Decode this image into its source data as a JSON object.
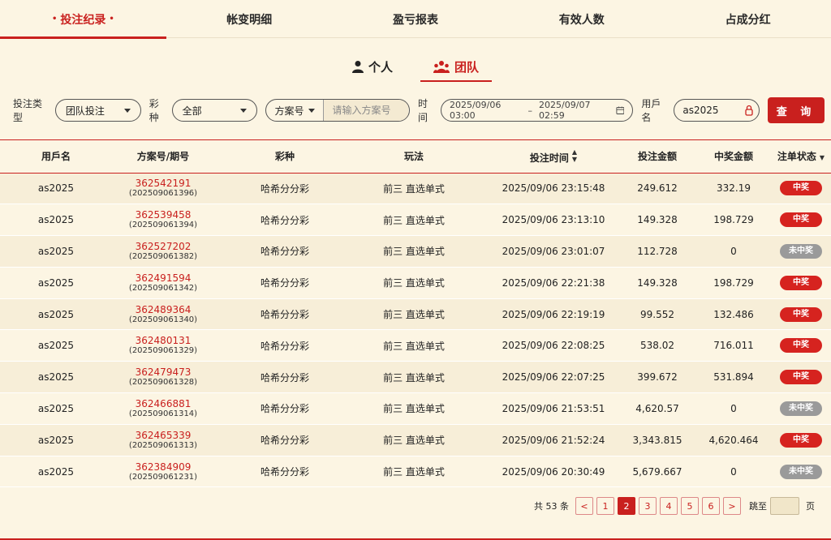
{
  "topnav": {
    "tabs": [
      {
        "label": "投注纪录",
        "active": true
      },
      {
        "label": "帐变明细",
        "active": false
      },
      {
        "label": "盈亏报表",
        "active": false
      },
      {
        "label": "有效人数",
        "active": false
      },
      {
        "label": "占成分红",
        "active": false
      }
    ]
  },
  "subtabs": {
    "personal": "个人",
    "team": "团队"
  },
  "filters": {
    "bet_type_label": "投注类型",
    "bet_type_value": "团队投注",
    "lottery_label": "彩种",
    "lottery_value": "全部",
    "plan_select_value": "方案号",
    "plan_input_placeholder": "请输入方案号",
    "time_label": "时间",
    "time_start": "2025/09/06 03:00",
    "time_sep": "–",
    "time_end": "2025/09/07 02:59",
    "username_label": "用戶名",
    "username_value": "as2025",
    "query_button": "查 询"
  },
  "table": {
    "headers": [
      "用戶名",
      "方案号/期号",
      "彩种",
      "玩法",
      "投注时间",
      "投注金额",
      "中奖金额",
      "注单状态"
    ],
    "rows": [
      {
        "user": "as2025",
        "plan": "362542191",
        "period": "(202509061396)",
        "lottery": "哈希分分彩",
        "play": "前三 直选单式",
        "time": "2025/09/06 23:15:48",
        "bet": "249.612",
        "win": "332.19",
        "status": "中奖"
      },
      {
        "user": "as2025",
        "plan": "362539458",
        "period": "(202509061394)",
        "lottery": "哈希分分彩",
        "play": "前三 直选单式",
        "time": "2025/09/06 23:13:10",
        "bet": "149.328",
        "win": "198.729",
        "status": "中奖"
      },
      {
        "user": "as2025",
        "plan": "362527202",
        "period": "(202509061382)",
        "lottery": "哈希分分彩",
        "play": "前三 直选单式",
        "time": "2025/09/06 23:01:07",
        "bet": "112.728",
        "win": "0",
        "status": "未中奖"
      },
      {
        "user": "as2025",
        "plan": "362491594",
        "period": "(202509061342)",
        "lottery": "哈希分分彩",
        "play": "前三 直选单式",
        "time": "2025/09/06 22:21:38",
        "bet": "149.328",
        "win": "198.729",
        "status": "中奖"
      },
      {
        "user": "as2025",
        "plan": "362489364",
        "period": "(202509061340)",
        "lottery": "哈希分分彩",
        "play": "前三 直选单式",
        "time": "2025/09/06 22:19:19",
        "bet": "99.552",
        "win": "132.486",
        "status": "中奖"
      },
      {
        "user": "as2025",
        "plan": "362480131",
        "period": "(202509061329)",
        "lottery": "哈希分分彩",
        "play": "前三 直选单式",
        "time": "2025/09/06 22:08:25",
        "bet": "538.02",
        "win": "716.011",
        "status": "中奖"
      },
      {
        "user": "as2025",
        "plan": "362479473",
        "period": "(202509061328)",
        "lottery": "哈希分分彩",
        "play": "前三 直选单式",
        "time": "2025/09/06 22:07:25",
        "bet": "399.672",
        "win": "531.894",
        "status": "中奖"
      },
      {
        "user": "as2025",
        "plan": "362466881",
        "period": "(202509061314)",
        "lottery": "哈希分分彩",
        "play": "前三 直选单式",
        "time": "2025/09/06 21:53:51",
        "bet": "4,620.57",
        "win": "0",
        "status": "未中奖"
      },
      {
        "user": "as2025",
        "plan": "362465339",
        "period": "(202509061313)",
        "lottery": "哈希分分彩",
        "play": "前三 直选单式",
        "time": "2025/09/06 21:52:24",
        "bet": "3,343.815",
        "win": "4,620.464",
        "status": "中奖"
      },
      {
        "user": "as2025",
        "plan": "362384909",
        "period": "(202509061231)",
        "lottery": "哈希分分彩",
        "play": "前三 直选单式",
        "time": "2025/09/06 20:30:49",
        "bet": "5,679.667",
        "win": "0",
        "status": "未中奖"
      }
    ]
  },
  "status_colors": {
    "中奖": "#d6231f",
    "未中奖": "#9a9a9a"
  },
  "pager": {
    "total_text": "共 53 条",
    "prev": "<",
    "next": ">",
    "pages": [
      "1",
      "2",
      "3",
      "4",
      "5",
      "6"
    ],
    "current": "2",
    "jump_label": "跳至",
    "page_suffix": "页"
  },
  "colors": {
    "accent": "#c9201e",
    "background": "#fcf5e3"
  }
}
